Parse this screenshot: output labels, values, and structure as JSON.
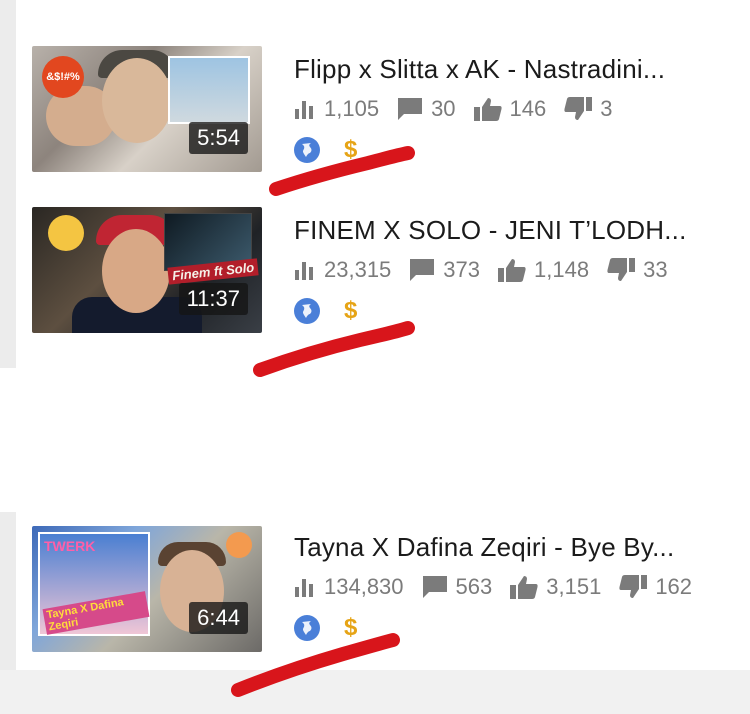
{
  "videos": [
    {
      "title": "Flipp x Slitta x AK - Nastradini...",
      "duration": "5:54",
      "badge_text": "&$!#%",
      "views": "1,105",
      "comments": "30",
      "likes": "146",
      "dislikes": "3"
    },
    {
      "title": "FINEM X SOLO - JENI T’LODH...",
      "duration": "11:37",
      "ribbon_text": "Finem ft Solo",
      "views": "23,315",
      "comments": "373",
      "likes": "1,148",
      "dislikes": "33"
    },
    {
      "title": "Tayna X Dafina Zeqiri - Bye By...",
      "duration": "6:44",
      "tag_text": "TWERK",
      "caption_text": "Tayna X Dafina Zeqiri",
      "views": "134,830",
      "comments": "563",
      "likes": "3,151",
      "dislikes": "162"
    }
  ],
  "icons": {
    "views": "bar-chart-icon",
    "comments": "comment-icon",
    "likes": "thumbs-up-icon",
    "dislikes": "thumbs-down-icon",
    "visibility": "globe-icon",
    "monetization": "dollar-icon"
  },
  "monetization_symbol": "$",
  "colors": {
    "stat_gray": "#7b7b7b",
    "globe_blue": "#4a7fd8",
    "dollar_gold": "#e6a416",
    "annotation_red": "#d8151b"
  }
}
